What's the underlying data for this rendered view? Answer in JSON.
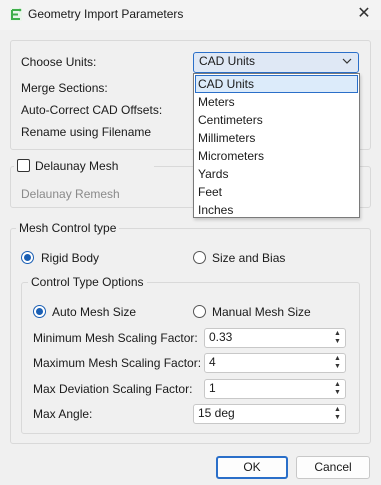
{
  "window": {
    "title": "Geometry Import Parameters",
    "close_glyph": "✕",
    "app_icon": "geometry-app-icon"
  },
  "import": {
    "units_label": "Choose Units:",
    "units_value": "CAD Units",
    "merge_label": "Merge Sections:",
    "autocorrect_label": "Auto-Correct CAD Offsets:",
    "rename_label": "Rename using Filename",
    "units_options": [
      "CAD Units",
      "Meters",
      "Centimeters",
      "Millimeters",
      "Micrometers",
      "Yards",
      "Feet",
      "Inches"
    ]
  },
  "delaunay": {
    "mesh_label": "Delaunay Mesh",
    "mesh_checked": false,
    "remesh_label": "Delaunay Remesh"
  },
  "mesh_control": {
    "legend": "Mesh Control type",
    "rigid_label": "Rigid Body",
    "size_bias_label": "Size and Bias",
    "selected": "Rigid Body"
  },
  "control_options": {
    "legend": "Control Type Options",
    "auto_label": "Auto Mesh Size",
    "manual_label": "Manual Mesh Size",
    "selected": "Auto Mesh Size",
    "fields": [
      {
        "label": "Minimum Mesh Scaling Factor:",
        "value": "0.33"
      },
      {
        "label": "Maximum Mesh Scaling Factor:",
        "value": "4"
      },
      {
        "label": "Max Deviation Scaling Factor:",
        "value": "1"
      },
      {
        "label": "Max Angle:",
        "value": "15 deg"
      }
    ]
  },
  "buttons": {
    "ok": "OK",
    "cancel": "Cancel"
  },
  "colors": {
    "accent": "#2a6fc9",
    "radio": "#1a5fb4",
    "combo_bg": "#dfe8f5",
    "dialog_bg": "#f0f0f0"
  }
}
